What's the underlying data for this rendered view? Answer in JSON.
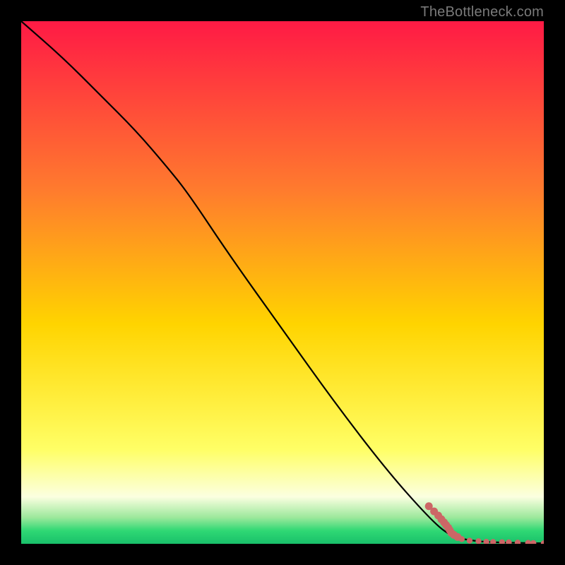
{
  "watermark": "TheBottleneck.com",
  "colors": {
    "background_black": "#000000",
    "line_black": "#000000",
    "marker": "#cc6666",
    "grad_top": "#ff1a45",
    "grad_mid_upper": "#ff7a2e",
    "grad_mid": "#ffd400",
    "grad_lower": "#ffff66",
    "grad_pale": "#fbffe0",
    "grad_green_light": "#9be89b",
    "grad_green": "#2fd874",
    "grad_green_deep": "#19c06a"
  },
  "chart_data": {
    "type": "line",
    "title": "",
    "xlabel": "",
    "ylabel": "",
    "xlim": [
      0,
      100
    ],
    "ylim": [
      0,
      100
    ],
    "series": [
      {
        "name": "curve",
        "x": [
          0,
          8,
          15,
          22,
          28,
          32,
          40,
          50,
          60,
          70,
          78,
          82,
          86,
          90,
          94,
          97,
          100
        ],
        "y": [
          100,
          93,
          86,
          79,
          72,
          67,
          55,
          41,
          27,
          14,
          5,
          1.5,
          0.6,
          0.3,
          0.2,
          0.15,
          0.1
        ]
      }
    ],
    "markers": {
      "name": "dotted-segment",
      "points": [
        {
          "x": 78.0,
          "y": 7.2
        },
        {
          "x": 79.0,
          "y": 6.2
        },
        {
          "x": 79.8,
          "y": 5.4
        },
        {
          "x": 80.4,
          "y": 4.7
        },
        {
          "x": 80.9,
          "y": 4.1
        },
        {
          "x": 81.3,
          "y": 3.6
        },
        {
          "x": 81.7,
          "y": 3.1
        },
        {
          "x": 82.0,
          "y": 2.6
        },
        {
          "x": 82.3,
          "y": 2.1
        },
        {
          "x": 82.8,
          "y": 1.7
        },
        {
          "x": 83.5,
          "y": 1.3
        },
        {
          "x": 84.3,
          "y": 0.9
        },
        {
          "x": 85.8,
          "y": 0.6
        },
        {
          "x": 87.5,
          "y": 0.5
        },
        {
          "x": 89.0,
          "y": 0.38
        },
        {
          "x": 90.3,
          "y": 0.34
        },
        {
          "x": 92.0,
          "y": 0.3
        },
        {
          "x": 93.3,
          "y": 0.27
        },
        {
          "x": 95.0,
          "y": 0.23
        },
        {
          "x": 97.0,
          "y": 0.18
        },
        {
          "x": 98.0,
          "y": 0.15
        },
        {
          "x": 100.0,
          "y": 0.1
        }
      ]
    },
    "gradient_bands_pct_from_top": [
      {
        "stop": 0,
        "color_key": "grad_top"
      },
      {
        "stop": 32,
        "color_key": "grad_mid_upper"
      },
      {
        "stop": 58,
        "color_key": "grad_mid"
      },
      {
        "stop": 82,
        "color_key": "grad_lower"
      },
      {
        "stop": 91,
        "color_key": "grad_pale"
      },
      {
        "stop": 95,
        "color_key": "grad_green_light"
      },
      {
        "stop": 97.5,
        "color_key": "grad_green"
      },
      {
        "stop": 100,
        "color_key": "grad_green_deep"
      }
    ]
  }
}
